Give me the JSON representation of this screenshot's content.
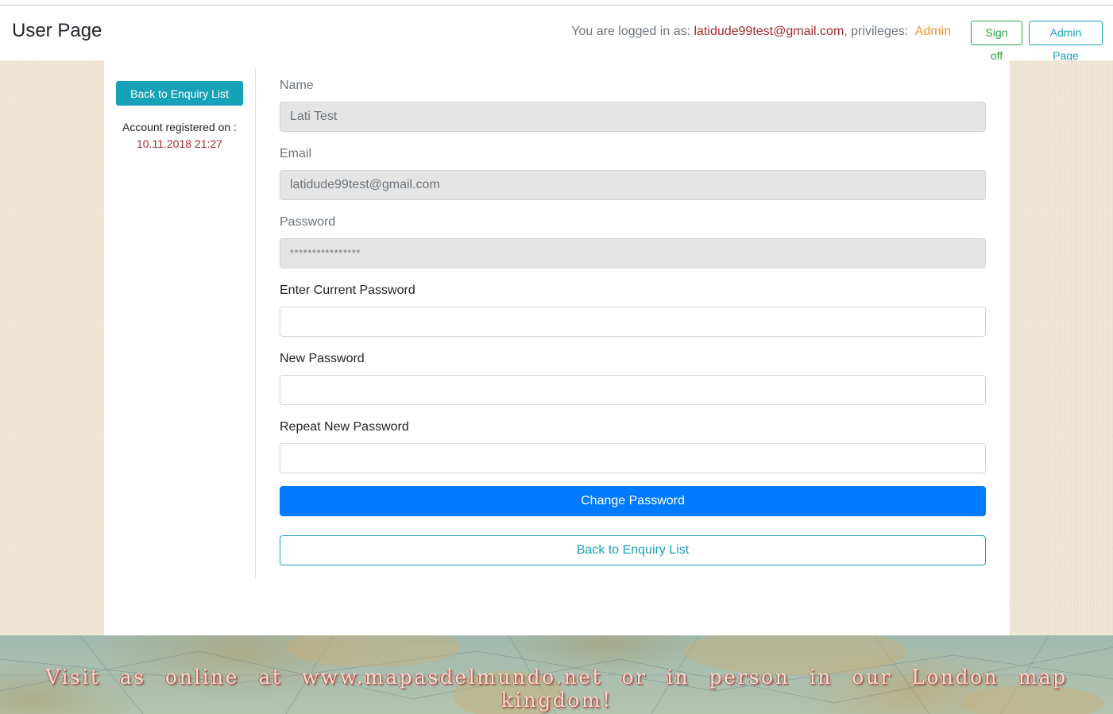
{
  "header": {
    "title": "User Page",
    "logged_in_prefix": "You are logged in as:",
    "user_email": "latidude99test@gmail.com",
    "privileges_prefix": ", privileges:",
    "privilege_level": "Admin",
    "signoff_label": "Sign off",
    "admin_page_label": "Admin Page"
  },
  "sidebar": {
    "back_label": "Back to Enquiry List",
    "registered_label": "Account registered on :",
    "registered_date": "10.11.2018 21:27"
  },
  "form": {
    "name_label": "Name",
    "name_value": "Lati Test",
    "email_label": "Email",
    "email_value": "latidude99test@gmail.com",
    "password_label": "Password",
    "password_value": "****************",
    "current_password_label": "Enter Current Password",
    "current_password_value": "",
    "new_password_label": "New Password",
    "new_password_value": "",
    "repeat_password_label": "Repeat New Password",
    "repeat_password_value": "",
    "change_password_label": "Change Password",
    "back_label": "Back to Enquiry List"
  },
  "footer": {
    "text": "Visit as online at www.mapasdelmundo.net or in person in our London map kingdom!"
  },
  "colors": {
    "primary": "#007bff",
    "info": "#17a2b8",
    "success": "#28a745",
    "email_red": "#a52a2a",
    "admin_orange": "#e8962a"
  }
}
